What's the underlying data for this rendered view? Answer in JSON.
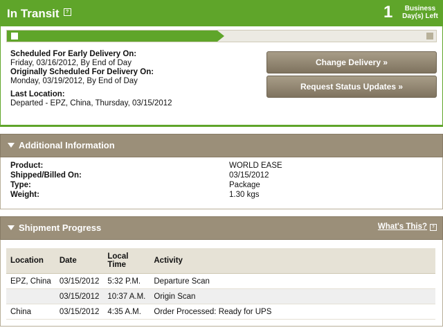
{
  "status": {
    "title": "In Transit",
    "info_icon": "info-icon",
    "days_left_number": "1",
    "days_left_label_1": "Business",
    "days_left_label_2": "Day(s) Left",
    "progress_fraction": 0.49
  },
  "delivery": {
    "early_label": "Scheduled For Early Delivery On:",
    "early_value": "Friday, 03/16/2012, By End of Day",
    "original_label": "Originally Scheduled For Delivery On:",
    "original_value": "Monday, 03/19/2012, By End of Day",
    "last_location_label": "Last Location:",
    "last_location_value": "Departed - EPZ, China, Thursday, 03/15/2012"
  },
  "buttons": {
    "change_delivery": "Change Delivery »",
    "request_updates": "Request Status Updates »"
  },
  "additional": {
    "heading": "Additional Information",
    "rows": [
      {
        "label": "Product:",
        "value": "WORLD EASE"
      },
      {
        "label": "Shipped/Billed On:",
        "value": "03/15/2012"
      },
      {
        "label": "Type:",
        "value": "Package"
      },
      {
        "label": "Weight:",
        "value": "1.30 kgs"
      }
    ]
  },
  "progress": {
    "heading": "Shipment Progress",
    "whats_this": "What's This?",
    "columns": [
      "Location",
      "Date",
      "Local Time",
      "Activity"
    ],
    "rows": [
      {
        "location": "EPZ, China",
        "date": "03/15/2012",
        "time": "5:32 P.M.",
        "activity": "Departure Scan"
      },
      {
        "location": "",
        "date": "03/15/2012",
        "time": "10:37 A.M.",
        "activity": "Origin Scan"
      },
      {
        "location": "China",
        "date": "03/15/2012",
        "time": "4:35 A.M.",
        "activity": "Order Processed: Ready for UPS"
      }
    ]
  },
  "colors": {
    "status_green": "#5fa52a",
    "section_brown": "#9b8f79",
    "button_brown": "#7f735f"
  }
}
